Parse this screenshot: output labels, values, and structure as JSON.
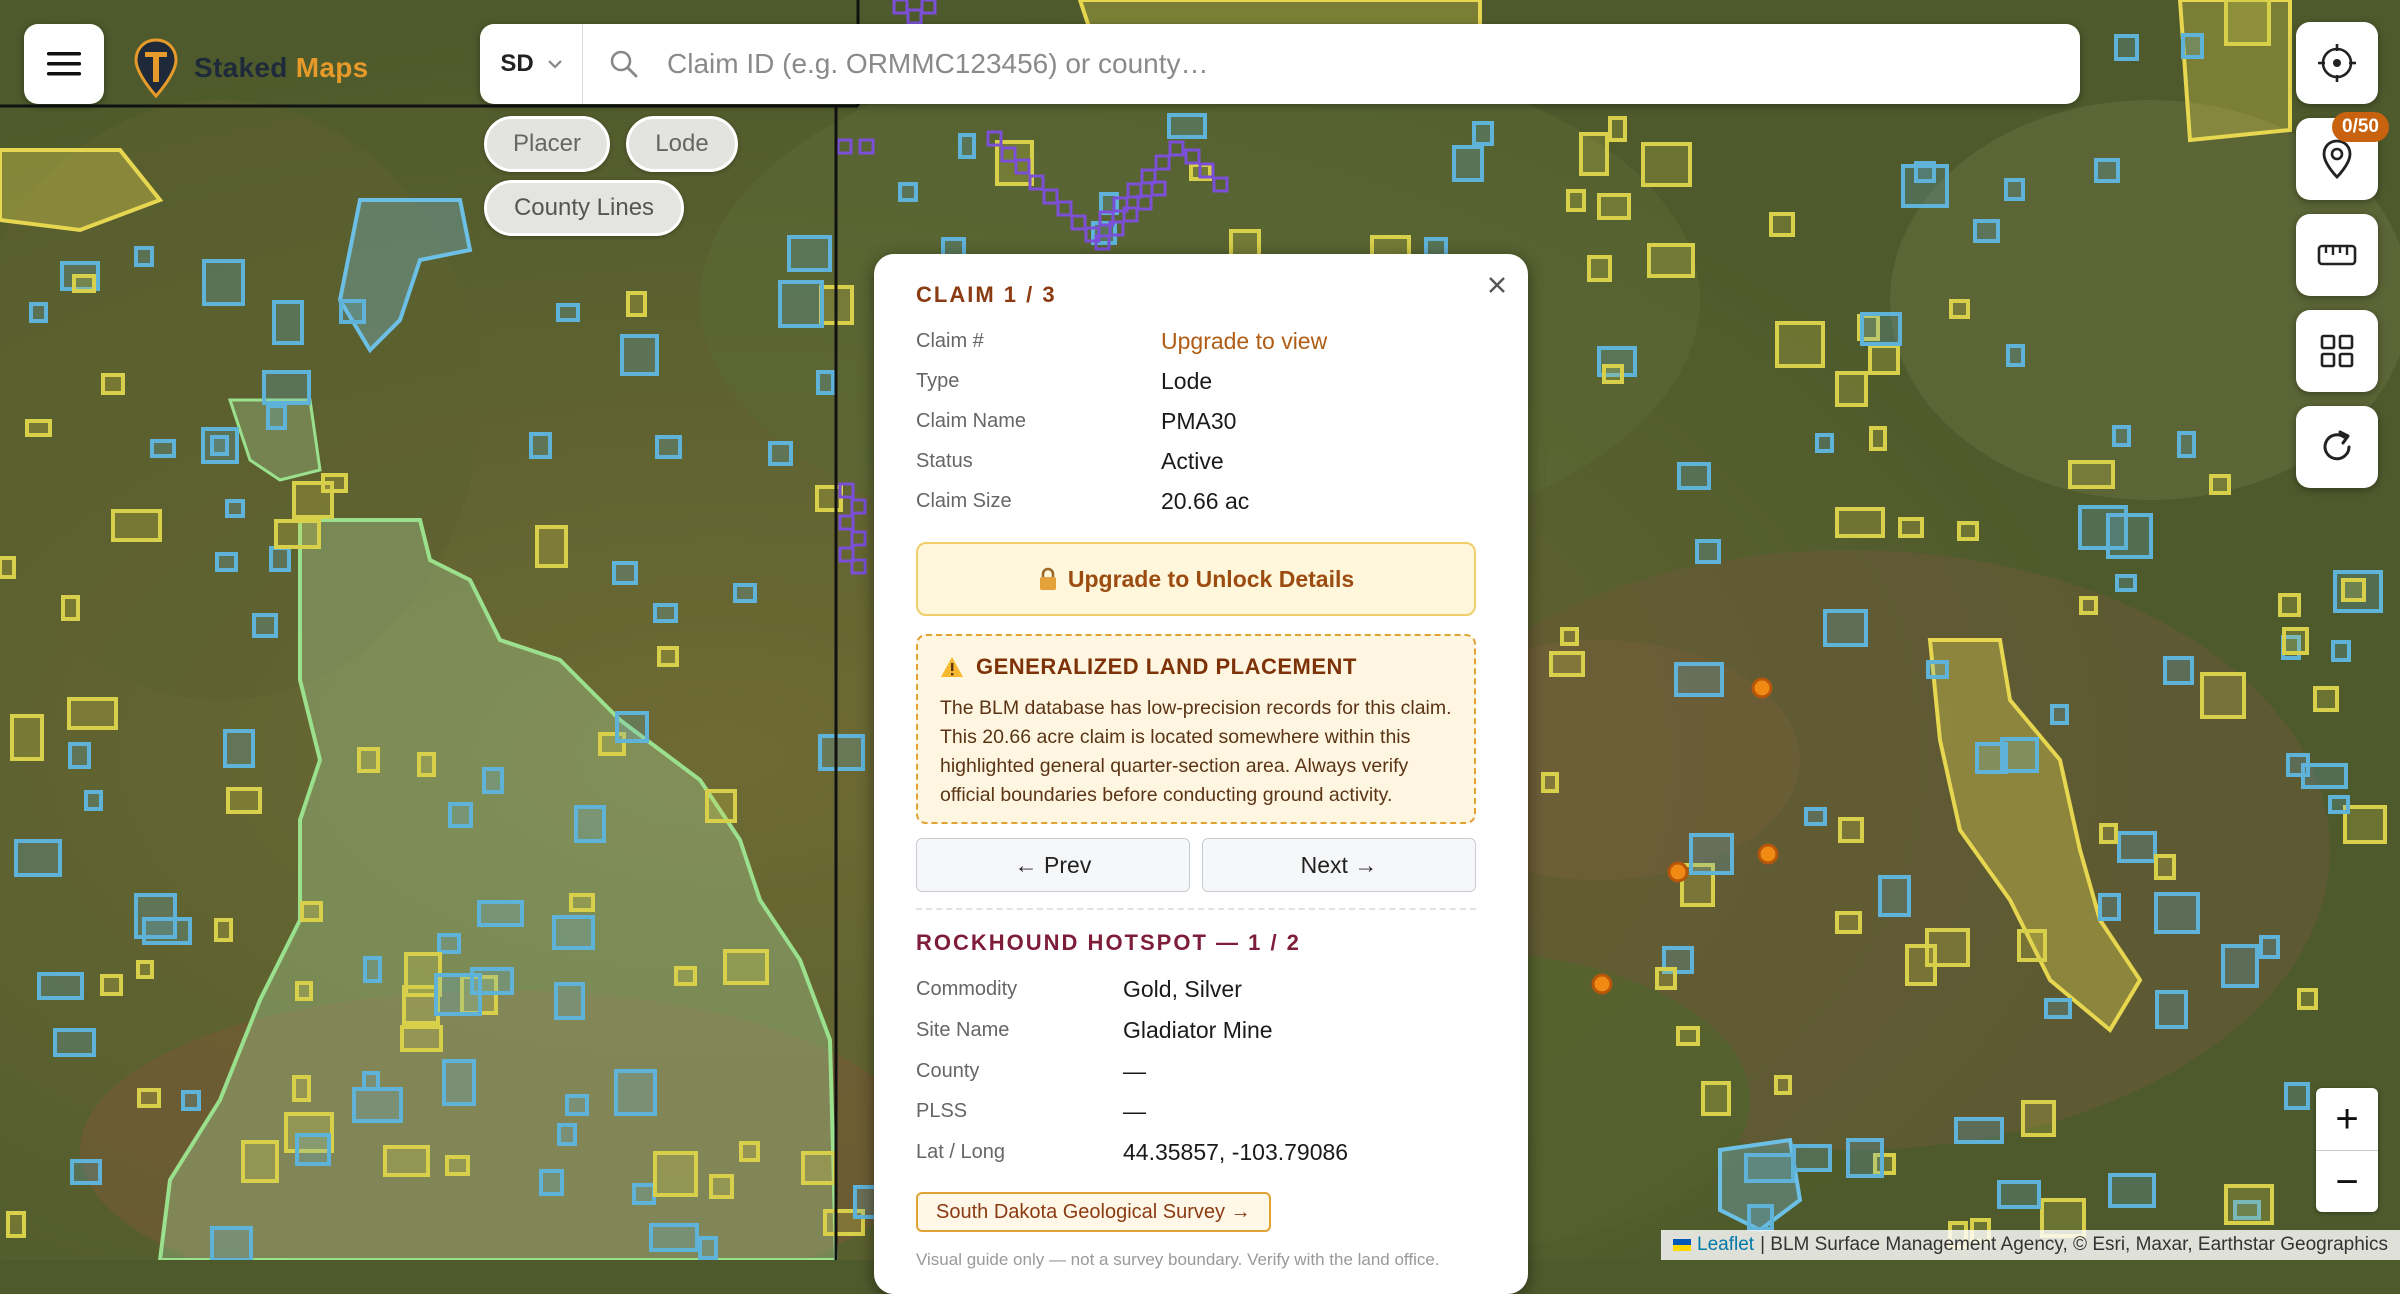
{
  "app": {
    "brand_primary": "Staked",
    "brand_accent": "Maps",
    "accent_color": "#e69a2a",
    "brand_color": "#1e2a3a"
  },
  "search": {
    "state": "SD",
    "placeholder": "Claim ID (e.g. ORMMC123456) or county…"
  },
  "filters": {
    "placer": "Placer",
    "lode": "Lode",
    "county_lines": "County Lines"
  },
  "map": {
    "layers": {
      "lode_color": "#5fb3d9",
      "placer_color": "#d8cf4a",
      "state_land_color": "#9bd08f",
      "selected_color": "#7b4fd8",
      "hotspot_color": "#f08a12"
    }
  },
  "controls": {
    "pin_count": "0/50",
    "zoom_in": "+",
    "zoom_out": "−"
  },
  "attribution": {
    "leaflet": "Leaflet",
    "sources": "| BLM Surface Management Agency, © Esri, Maxar, Earthstar Geographics"
  },
  "popup": {
    "claim_title": "CLAIM 1 / 3",
    "claim_fields": [
      {
        "label": "Claim #",
        "value": "Upgrade to view"
      },
      {
        "label": "Type",
        "value": "Lode"
      },
      {
        "label": "Claim Name",
        "value": "PMA30"
      },
      {
        "label": "Status",
        "value": "Active"
      },
      {
        "label": "Claim Size",
        "value": "20.66 ac"
      }
    ],
    "upgrade_label": "Upgrade to Unlock Details",
    "warning_title": "GENERALIZED LAND PLACEMENT",
    "warning_text": "The BLM database has low-precision records for this claim. This 20.66 acre claim is located somewhere within this highlighted general quarter-section area. Always verify official boundaries before conducting ground activity.",
    "prev_label": "← Prev",
    "next_label": "Next →",
    "hotspot_title": "ROCKHOUND HOTSPOT — 1 / 2",
    "hotspot_fields": [
      {
        "label": "Commodity",
        "value": "Gold, Silver"
      },
      {
        "label": "Site Name",
        "value": "Gladiator Mine"
      },
      {
        "label": "County",
        "value": "—"
      },
      {
        "label": "PLSS",
        "value": "—"
      },
      {
        "label": "Lat / Long",
        "value": "44.35857, -103.79086"
      }
    ],
    "source_link": "South Dakota Geological Survey →",
    "footer_text": "Visual guide only — not a survey boundary. Verify with the land office."
  }
}
